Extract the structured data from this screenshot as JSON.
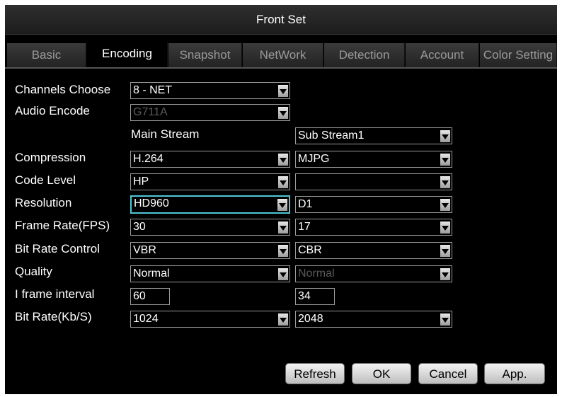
{
  "window": {
    "title": "Front Set"
  },
  "tabs": [
    {
      "label": "Basic"
    },
    {
      "label": "Encoding"
    },
    {
      "label": "Snapshot"
    },
    {
      "label": "NetWork"
    },
    {
      "label": "Detection"
    },
    {
      "label": "Account"
    },
    {
      "label": "Color Setting"
    }
  ],
  "channels": {
    "label": "Channels Choose",
    "value": "8 - NET"
  },
  "audio": {
    "label": "Audio Encode",
    "value": "G711A"
  },
  "streams": {
    "main_header": "Main Stream",
    "sub_value": "Sub Stream1"
  },
  "rows": {
    "compression": {
      "label": "Compression",
      "main": "H.264",
      "sub": "MJPG"
    },
    "code_level": {
      "label": "Code Level",
      "main": "HP",
      "sub": ""
    },
    "resolution": {
      "label": "Resolution",
      "main": "HD960",
      "sub": "D1"
    },
    "frame_rate": {
      "label": "Frame Rate(FPS)",
      "main": "30",
      "sub": "17"
    },
    "bitrate_control": {
      "label": "Bit Rate Control",
      "main": "VBR",
      "sub": "CBR"
    },
    "quality": {
      "label": "Quality",
      "main": "Normal",
      "sub": "Normal"
    },
    "iframe": {
      "label": "I frame interval",
      "main": "60",
      "sub": "34"
    },
    "bitrate": {
      "label": "Bit Rate(Kb/S)",
      "main": "1024",
      "sub": "2048"
    }
  },
  "buttons": {
    "refresh": "Refresh",
    "ok": "OK",
    "cancel": "Cancel",
    "apply": "App."
  },
  "colors": {
    "background": "#000000",
    "text": "#ffffff",
    "focus": "#4fc7d6",
    "inactive_tab": "#9a9a9a"
  }
}
